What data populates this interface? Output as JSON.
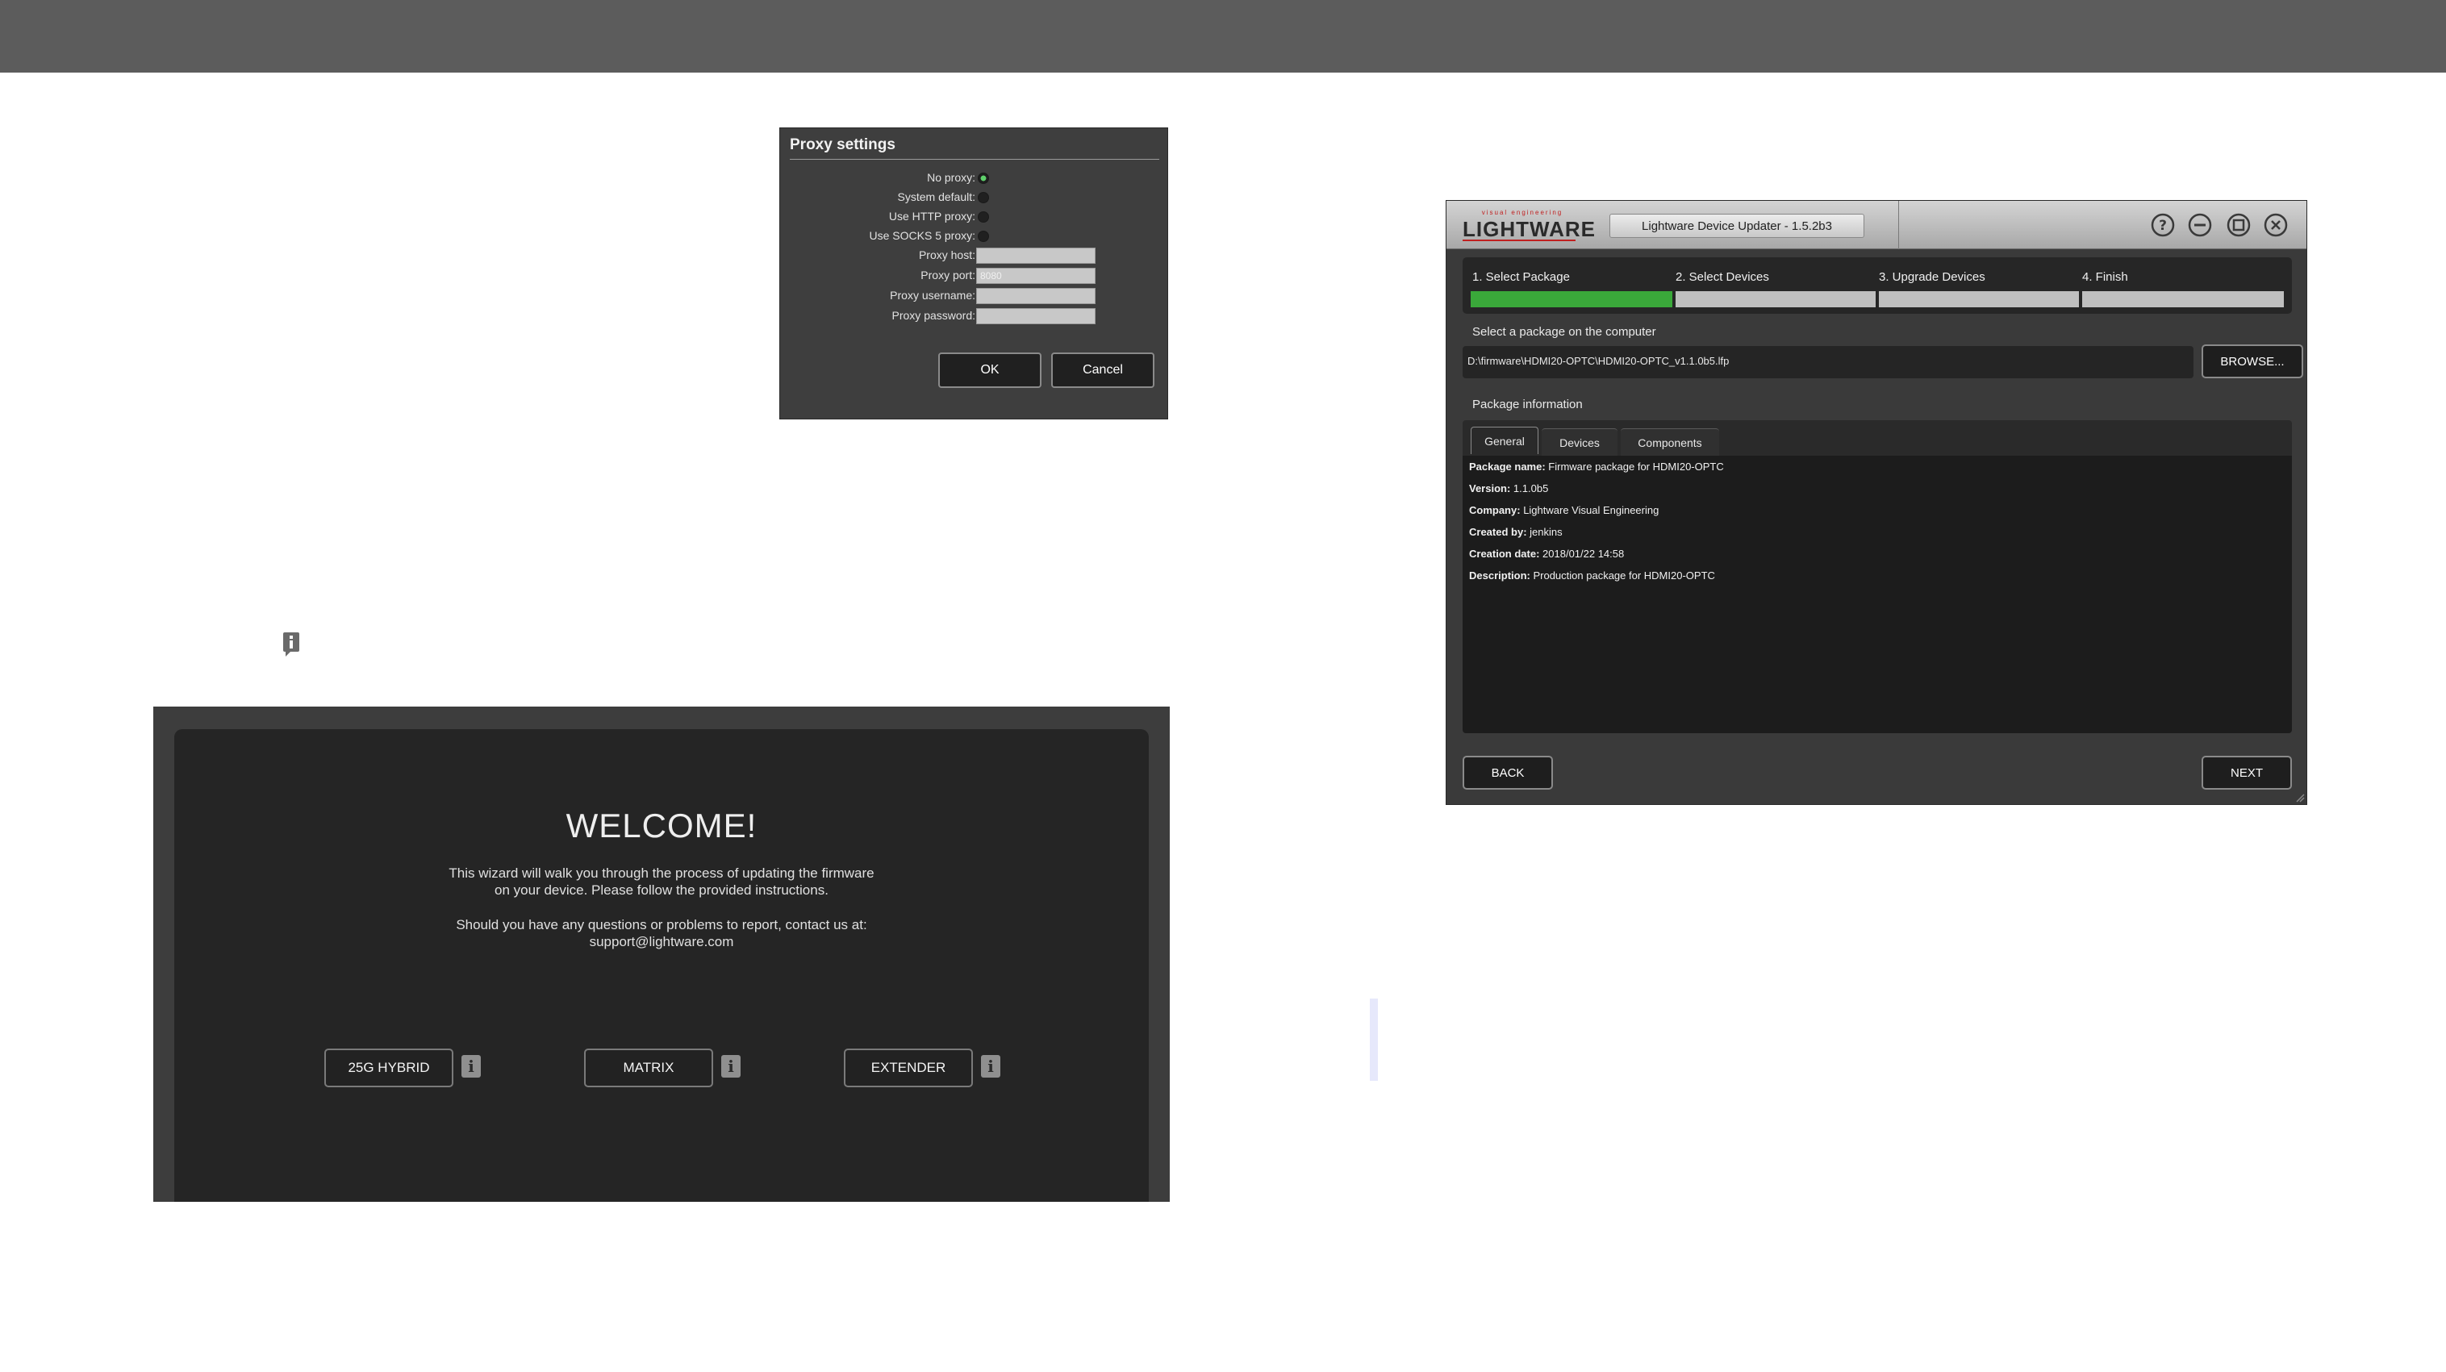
{
  "proxy": {
    "title": "Proxy settings",
    "radios": [
      {
        "label": "No proxy:",
        "selected": true
      },
      {
        "label": "System default:",
        "selected": false
      },
      {
        "label": "Use HTTP proxy:",
        "selected": false
      },
      {
        "label": "Use SOCKS 5 proxy:",
        "selected": false
      }
    ],
    "fields": [
      {
        "label": "Proxy host:",
        "value": ""
      },
      {
        "label": "Proxy port:",
        "value": "8080"
      },
      {
        "label": "Proxy username:",
        "value": ""
      },
      {
        "label": "Proxy password:",
        "value": ""
      }
    ],
    "ok_label": "OK",
    "cancel_label": "Cancel"
  },
  "welcome": {
    "title": "WELCOME!",
    "line1": "This wizard will walk you through the process of updating the firmware",
    "line2": "on your device. Please follow the provided instructions.",
    "line3": "Should you have any questions or problems to report, contact us at:",
    "email": "support@lightware.com",
    "buttons": [
      "25G HYBRID",
      "MATRIX",
      "EXTENDER"
    ]
  },
  "updater": {
    "logo_tagline": "visual engineering",
    "logo_text": "LIGHTWARE",
    "window_title": "Lightware Device Updater - 1.5.2b3",
    "steps": [
      "1. Select Package",
      "2. Select Devices",
      "3. Upgrade Devices",
      "4. Finish"
    ],
    "active_step": 1,
    "select_label": "Select a package on the computer",
    "path": "D:\\firmware\\HDMI20-OPTC\\HDMI20-OPTC_v1.1.0b5.lfp",
    "browse_label": "BROWSE...",
    "package_info_label": "Package information",
    "tabs": [
      "General",
      "Devices",
      "Components"
    ],
    "info": [
      {
        "key": "Package name:",
        "value": "Firmware package for HDMI20-OPTC"
      },
      {
        "key": "Version:",
        "value": "1.1.0b5"
      },
      {
        "key": "Company:",
        "value": "Lightware Visual Engineering"
      },
      {
        "key": "Created by:",
        "value": "jenkins"
      },
      {
        "key": "Creation date:",
        "value": "2018/01/22 14:58"
      },
      {
        "key": "Description:",
        "value": "Production package for HDMI20-OPTC"
      }
    ],
    "back_label": "BACK",
    "next_label": "NEXT"
  },
  "colors": {
    "progress_active": "#3aa83a",
    "logo_red": "#c02020",
    "radio_selected": "#5ed06a"
  }
}
